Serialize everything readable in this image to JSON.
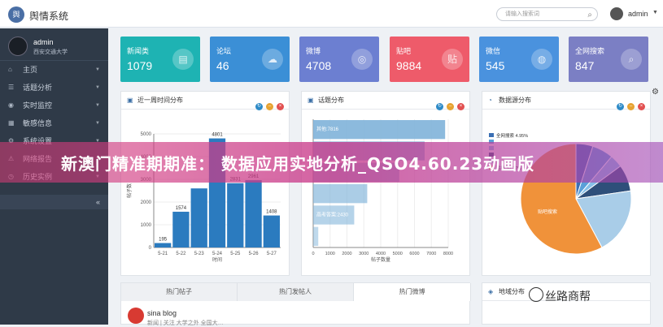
{
  "app": {
    "title": "舆情系统",
    "logo_text": "舆"
  },
  "topbar": {
    "search_placeholder": "请输入搜索词",
    "user": "admin"
  },
  "sidebar": {
    "user_name": "admin",
    "user_org": "西安交通大学",
    "items": [
      {
        "label": "主页",
        "icon": "home-icon"
      },
      {
        "label": "话题分析",
        "icon": "list-icon"
      },
      {
        "label": "实时监控",
        "icon": "eye-icon"
      },
      {
        "label": "敏感信息",
        "icon": "table-icon"
      },
      {
        "label": "系统设置",
        "icon": "gear-icon"
      },
      {
        "label": "网络报告",
        "icon": "report-icon"
      },
      {
        "label": "历史实例",
        "icon": "history-icon"
      }
    ],
    "collapse_label": "«"
  },
  "stats": [
    {
      "label": "新闻类",
      "value": "1079",
      "color": "#1eb3b3",
      "icon": "document-icon"
    },
    {
      "label": "论坛",
      "value": "46",
      "color": "#3b8fd6",
      "icon": "chat-icon"
    },
    {
      "label": "微博",
      "value": "4708",
      "color": "#6c7fd1",
      "icon": "weibo-icon"
    },
    {
      "label": "贴吧",
      "value": "9884",
      "color": "#ee5b6a",
      "icon": "tieba-icon"
    },
    {
      "label": "微信",
      "value": "545",
      "color": "#4a92de",
      "icon": "wechat-icon"
    },
    {
      "label": "全网搜索",
      "value": "847",
      "color": "#7b7fc4",
      "icon": "search-icon"
    }
  ],
  "panels": {
    "trend": {
      "title": "近一周时间分布"
    },
    "topics": {
      "title": "话题分布"
    },
    "source": {
      "title": "数据源分布"
    },
    "region": {
      "title": "地域分布"
    }
  },
  "chart_data": [
    {
      "type": "bar",
      "title": "近一周时间分布",
      "xlabel": "时间",
      "ylabel": "帖子数",
      "categories": [
        "5-21",
        "5-22",
        "5-23",
        "5-24",
        "5-25",
        "5-26",
        "5-27"
      ],
      "values": [
        195,
        1574,
        2600,
        4801,
        2831,
        2961,
        1408
      ],
      "value_labels": [
        "195",
        "1574",
        "",
        "4801",
        "2831",
        "2961",
        "1408"
      ],
      "ylim": [
        0,
        5000
      ],
      "yticks": [
        0,
        1000,
        2000,
        3000,
        4000,
        5000
      ],
      "color": "#2b7bbf"
    },
    {
      "type": "bar",
      "orientation": "horizontal",
      "title": "话题分布",
      "xlabel": "帖子数量",
      "categories": [
        "其他",
        "",
        "",
        "",
        "高考答案",
        ""
      ],
      "values": [
        7816,
        6600,
        5100,
        3200,
        2430,
        300
      ],
      "value_labels": [
        "其他:7816",
        "",
        "",
        "",
        "高考答案:2430",
        ""
      ],
      "xlim": [
        0,
        8000
      ],
      "xticks": [
        0,
        1000,
        2000,
        3000,
        4000,
        5000,
        6000,
        7000,
        8000
      ],
      "color": "#7fb3d9"
    },
    {
      "type": "pie",
      "title": "数据源分布",
      "slices": [
        {
          "name": "全网搜索",
          "value": 4.95,
          "color": "#3b6fb4"
        },
        {
          "name": "论坛",
          "value": 6.2,
          "color": "#5aa0d8"
        },
        {
          "name": "微信",
          "value": 3.75,
          "color": "#87c0e8"
        },
        {
          "name": "新闻类",
          "value": 7.8,
          "color": "#2e4f7a"
        },
        {
          "name": "微博",
          "value": 19.5,
          "color": "#a9cde8"
        },
        {
          "name": "贴吧",
          "value": 57.77,
          "color": "#f0923a"
        }
      ],
      "legend_texts": [
        "全网搜索 4.95%",
        "",
        "",
        "",
        "",
        "贴吧 57.77%"
      ],
      "slice_label": "贴吧搜索"
    }
  ],
  "tabs": [
    {
      "label": "热门帖子"
    },
    {
      "label": "热门发帖人"
    },
    {
      "label": "热门微博"
    }
  ],
  "feed": {
    "name": "sina blog",
    "snippet": "新闻 | 关注 大学之外 全国大…"
  },
  "banner": {
    "text": "新澳门精准期期准： 数据应用实地分析_QSO4.60.23动画版"
  },
  "watermark": {
    "text": "丝路商帮"
  }
}
